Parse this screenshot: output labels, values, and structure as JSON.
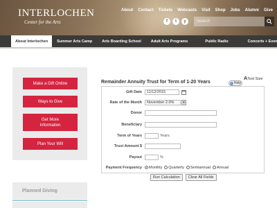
{
  "header": {
    "logo_title": "INTERLOCHEN",
    "logo_subtitle": "Center for the Arts",
    "top_links": [
      "About",
      "Contact",
      "Tickets",
      "Webcasts",
      "Visit",
      "Shop",
      "Jobs",
      "Alumni",
      "Give"
    ],
    "social": [
      "f",
      "t",
      "y"
    ],
    "search_placeholder": "Search"
  },
  "main_nav": [
    "About Interlochen",
    "Summer Arts Camp",
    "Arts Boarding School",
    "Adult Arts Programs",
    "Public Radio",
    "Concerts + Events"
  ],
  "sidebar": {
    "buttons": [
      "Make a Gift Online",
      "Ways to Give",
      "Get More Information",
      "Plan Your Will"
    ],
    "section_title": "Planned Giving"
  },
  "calculator": {
    "text_size_label": "Text Size",
    "title": "Remainder Annuity Trust for Term of 1-20 Years",
    "help_label": "Help",
    "fields": {
      "gift_date_label": "Gift Date",
      "gift_date_value": "11/12/2015",
      "rate_label": "Rate of the Month",
      "rate_value": "November 2.0%",
      "donor_label": "Donor",
      "beneficiary_label": "Beneficiary",
      "term_label": "Term of Years",
      "term_suffix": "Years",
      "trust_amount_label": "Trust Amount $",
      "payout_label": "Payout",
      "payout_suffix": "%",
      "frequency_label": "Payment Frequency",
      "frequency_options": [
        "Monthly",
        "Quarterly",
        "Semiannual",
        "Annual"
      ],
      "frequency_selected": "Monthly"
    },
    "run_button": "Run Calculation",
    "clear_button": "Clear All Fields"
  },
  "colors": {
    "accent_red": "#d4243f",
    "nav_dark": "#3c3a38",
    "sidebar_bg": "#ebebeb",
    "highlight_line": "#9fd0dc"
  }
}
